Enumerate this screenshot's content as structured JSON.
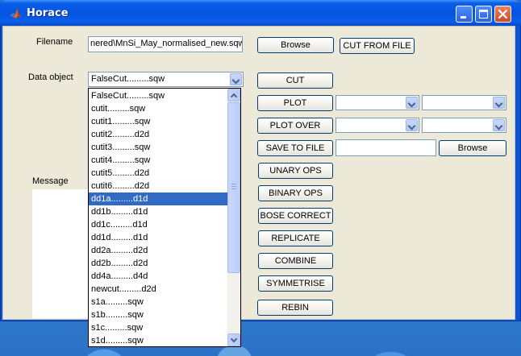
{
  "window": {
    "title": "Horace"
  },
  "colors": {
    "titlebar": "#0553e1",
    "selection": "#316ac5",
    "client_bg": "#ece9d8"
  },
  "filename": {
    "label": "Filename",
    "value": "nered\\MnSi_May_normalised_new.sqw"
  },
  "buttons": {
    "browse": "Browse",
    "cut_from_file": "CUT FROM FILE",
    "cut": "CUT",
    "plot": "PLOT",
    "plot_over": "PLOT OVER",
    "save_to_file": "SAVE TO FILE",
    "save_browse": "Browse",
    "unary_ops": "UNARY OPS",
    "binary_ops": "BINARY OPS",
    "bose_correct": "BOSE CORRECT",
    "replicate": "REPLICATE",
    "combine": "COMBINE",
    "symmetrise": "SYMMETRISE",
    "rebin": "REBIN"
  },
  "data_object": {
    "label": "Data object",
    "selected": "FalseCut.........sqw",
    "options": [
      "FalseCut.........sqw",
      "cutit.........sqw",
      "cutit1.........sqw",
      "cutit2.........d2d",
      "cutit3.........sqw",
      "cutit4.........sqw",
      "cutit5.........d2d",
      "cutit6.........d2d",
      "dd1a.........d1d",
      "dd1b.........d1d",
      "dd1c.........d1d",
      "dd1d.........d1d",
      "dd2a.........d2d",
      "dd2b.........d2d",
      "dd4a.........d4d",
      "newcut.........d2d",
      "s1a.........sqw",
      "s1b.........sqw",
      "s1c.........sqw",
      "s1d.........sqw"
    ],
    "highlighted_index": 8
  },
  "save_to_file": {
    "value": ""
  },
  "message": {
    "label": "Message"
  },
  "icons": {
    "app": "matlab-logo-icon",
    "minimize": "minimize-icon",
    "maximize": "maximize-icon",
    "close": "close-icon"
  }
}
